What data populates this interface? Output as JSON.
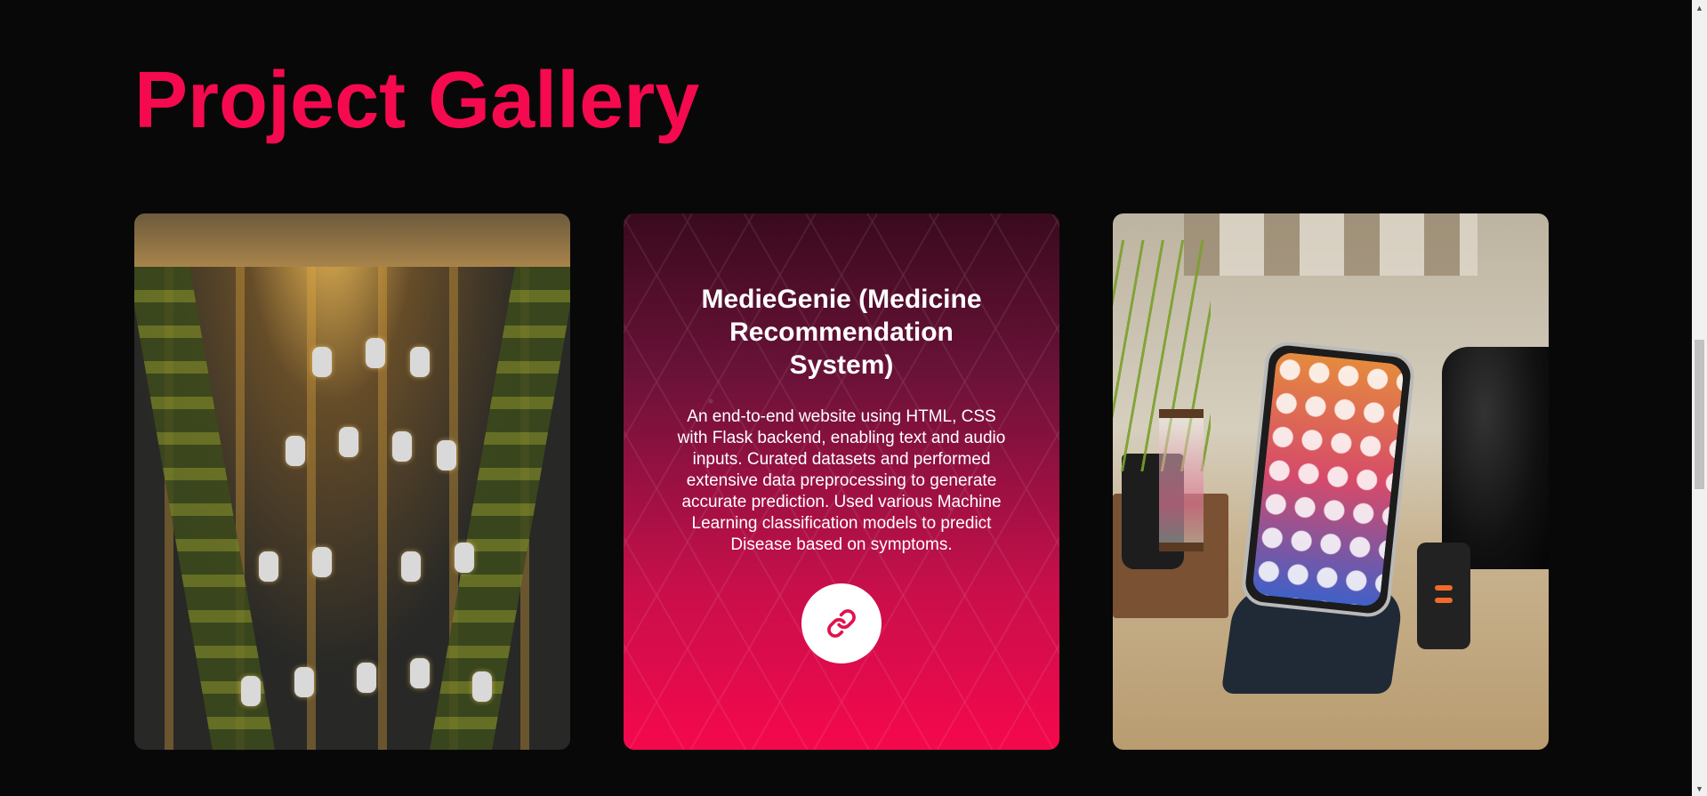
{
  "page": {
    "title": "Project Gallery",
    "accent_color": "#f50a4f",
    "background_color": "#080808"
  },
  "gallery": {
    "cards": [
      {
        "type": "image",
        "image_subject": "aerial-parking-lot-photo"
      },
      {
        "type": "project",
        "title": "MedieGenie (Medicine Recommendation System)",
        "description": "An end-to-end website using HTML, CSS with Flask backend, enabling text and audio inputs. Curated datasets and performed extensive data preprocessing to generate accurate prediction. Used various Machine Learning classification models to predict Disease based on symptoms.",
        "link_icon": "link-icon"
      },
      {
        "type": "image",
        "image_subject": "smartphone-on-stand-photo"
      }
    ]
  },
  "scrollbar": {
    "up_icon": "chevron-up-icon",
    "down_icon": "chevron-down-icon"
  }
}
